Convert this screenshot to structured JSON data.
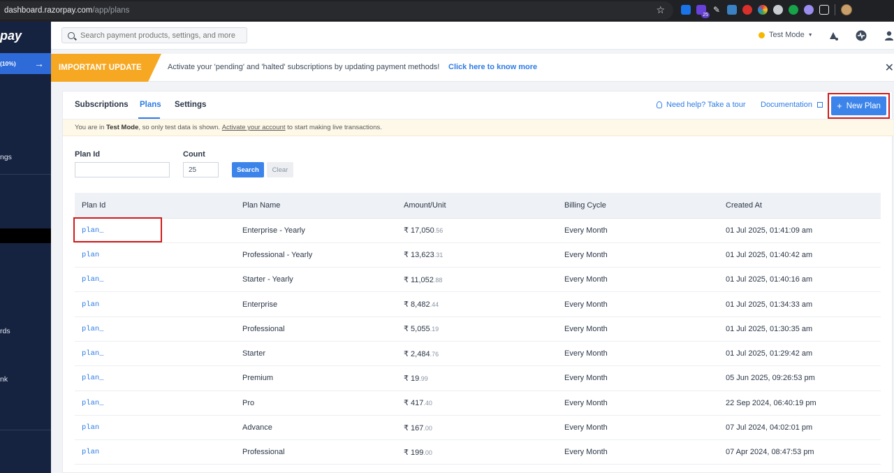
{
  "browser": {
    "url_host": "dashboard.razorpay.com",
    "url_path": "/app/plans",
    "ext_badge_count": "25"
  },
  "sidebar": {
    "logo": "pay",
    "promo": "(10%)",
    "items": [
      {
        "label": "ngs"
      },
      {
        "label": "rds"
      },
      {
        "label": "nk"
      }
    ]
  },
  "topbar": {
    "search_placeholder": "Search payment products, settings, and more",
    "mode_label": "Test Mode"
  },
  "banner": {
    "tag": "IMPORTANT UPDATE",
    "message": "Activate your 'pending' and 'halted' subscriptions by updating payment methods!",
    "link": "Click here to know more"
  },
  "tabs": [
    {
      "label": "Subscriptions",
      "active": false
    },
    {
      "label": "Plans",
      "active": true
    },
    {
      "label": "Settings",
      "active": false
    }
  ],
  "help_link": "Need help? Take a tour",
  "doc_link": "Documentation",
  "new_plan_label": "New Plan",
  "testmode_notice": {
    "prefix": "You are in ",
    "mode": "Test Mode",
    "middle": ", so only test data is shown. ",
    "link": "Activate your account",
    "suffix": " to start making live transactions."
  },
  "filters": {
    "plan_id_label": "Plan Id",
    "plan_id_value": "",
    "count_label": "Count",
    "count_value": "25",
    "search_label": "Search",
    "clear_label": "Clear"
  },
  "table": {
    "columns": [
      "Plan Id",
      "Plan Name",
      "Amount/Unit",
      "Billing Cycle",
      "Created At"
    ],
    "rows": [
      {
        "id": "plan_",
        "name": "Enterprise - Yearly",
        "amount": "₹ 17,050",
        "cents": ".56",
        "cycle": "Every Month",
        "created": "01 Jul 2025, 01:41:09 am"
      },
      {
        "id": "plan",
        "name": "Professional - Yearly",
        "amount": "₹ 13,623",
        "cents": ".31",
        "cycle": "Every Month",
        "created": "01 Jul 2025, 01:40:42 am"
      },
      {
        "id": "plan_",
        "name": "Starter - Yearly",
        "amount": "₹ 11,052",
        "cents": ".88",
        "cycle": "Every Month",
        "created": "01 Jul 2025, 01:40:16 am"
      },
      {
        "id": "plan",
        "name": "Enterprise",
        "amount": "₹ 8,482",
        "cents": ".44",
        "cycle": "Every Month",
        "created": "01 Jul 2025, 01:34:33 am"
      },
      {
        "id": "plan_",
        "name": "Professional",
        "amount": "₹ 5,055",
        "cents": ".19",
        "cycle": "Every Month",
        "created": "01 Jul 2025, 01:30:35 am"
      },
      {
        "id": "plan_",
        "name": "Starter",
        "amount": "₹ 2,484",
        "cents": ".76",
        "cycle": "Every Month",
        "created": "01 Jul 2025, 01:29:42 am"
      },
      {
        "id": "plan_",
        "name": "Premium",
        "amount": "₹ 19",
        "cents": ".99",
        "cycle": "Every Month",
        "created": "05 Jun 2025, 09:26:53 pm"
      },
      {
        "id": "plan_",
        "name": "Pro",
        "amount": "₹ 417",
        "cents": ".40",
        "cycle": "Every Month",
        "created": "22 Sep 2024, 06:40:19 pm"
      },
      {
        "id": "plan",
        "name": "Advance",
        "amount": "₹ 167",
        "cents": ".00",
        "cycle": "Every Month",
        "created": "07 Jul 2024, 04:02:01 pm"
      },
      {
        "id": "plan",
        "name": "Professional",
        "amount": "₹ 199",
        "cents": ".00",
        "cycle": "Every Month",
        "created": "07 Apr 2024, 08:47:53 pm"
      }
    ]
  }
}
